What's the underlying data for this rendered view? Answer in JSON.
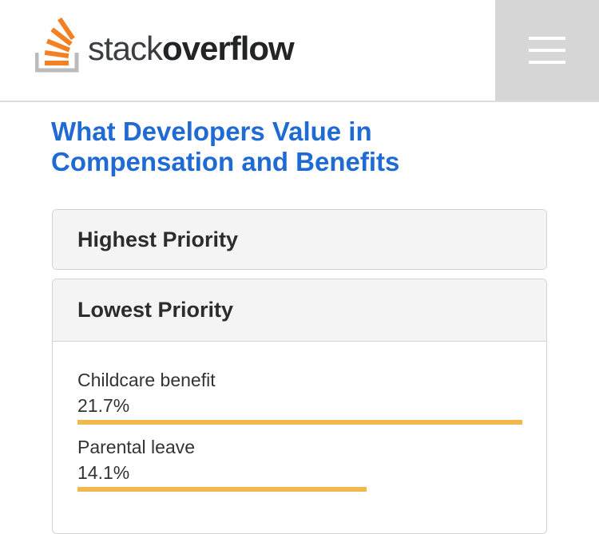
{
  "header": {
    "logo_text_light": "stack",
    "logo_text_bold": "overflow",
    "menu_icon": "hamburger-menu-icon",
    "logo_icon": "stackoverflow-logo-icon"
  },
  "page": {
    "title": "What Developers Value in Compensation and Benefits"
  },
  "panels": [
    {
      "label": "Highest Priority"
    },
    {
      "label": "Lowest Priority",
      "items": [
        {
          "label": "Childcare benefit",
          "value": "21.7%",
          "fraction": 1.0
        },
        {
          "label": "Parental leave",
          "value": "14.1%",
          "fraction": 0.65
        }
      ]
    }
  ],
  "colors": {
    "title": "#1f6ad3",
    "bar": "#f1b84e",
    "logo_orange": "#f48024",
    "logo_gray": "#bcbbbb",
    "menu_bg": "#d6d6d6"
  }
}
